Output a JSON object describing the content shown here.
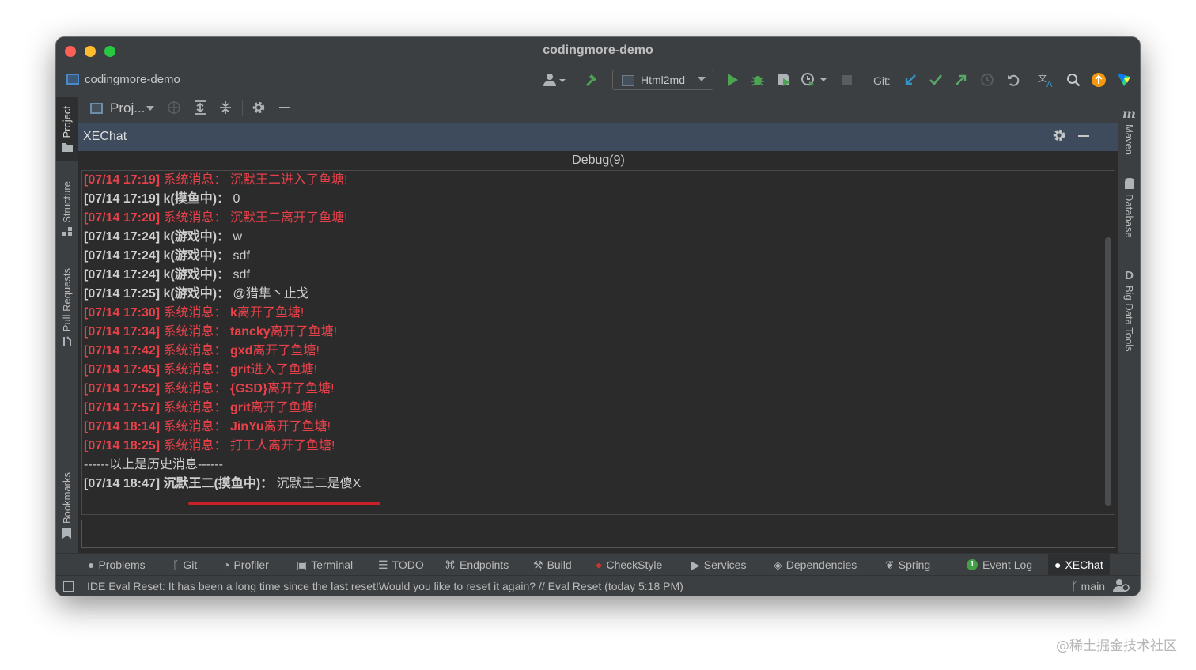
{
  "window": {
    "title": "codingmore-demo"
  },
  "navbar": {
    "project_name": "codingmore-demo",
    "run_config": "Html2md",
    "git_label": "Git:"
  },
  "left_stripe": {
    "project": "Project",
    "structure": "Structure",
    "pull_requests": "Pull Requests",
    "bookmarks": "Bookmarks"
  },
  "right_stripe": {
    "maven": "Maven",
    "database": "Database",
    "big_data_tools": "Big Data Tools"
  },
  "project_toolbar": {
    "label": "Proj..."
  },
  "panel": {
    "title": "XEChat",
    "tab": "Debug(9)"
  },
  "chat": {
    "lines": [
      {
        "type": "sys",
        "time": "[07/14 17:19]",
        "sender": "系统消息：",
        "name": "",
        "text": "沉默王二进入了鱼塘!"
      },
      {
        "type": "user",
        "time": "[07/14 17:19]",
        "sender": "k(摸鱼中)：",
        "name": "",
        "text": "0"
      },
      {
        "type": "sys",
        "time": "[07/14 17:20]",
        "sender": "系统消息：",
        "name": "",
        "text": "沉默王二离开了鱼塘!"
      },
      {
        "type": "user",
        "time": "[07/14 17:24]",
        "sender": "k(游戏中)：",
        "name": "",
        "text": "w"
      },
      {
        "type": "user",
        "time": "[07/14 17:24]",
        "sender": "k(游戏中)：",
        "name": "",
        "text": "sdf"
      },
      {
        "type": "user",
        "time": "[07/14 17:24]",
        "sender": "k(游戏中)：",
        "name": "",
        "text": "sdf"
      },
      {
        "type": "user",
        "time": "[07/14 17:25]",
        "sender": "k(游戏中)：",
        "name": "",
        "text": "@猎隼丶止戈"
      },
      {
        "type": "sys",
        "time": "[07/14 17:30]",
        "sender": "系统消息：",
        "name": "k",
        "text": "离开了鱼塘!"
      },
      {
        "type": "sys",
        "time": "[07/14 17:34]",
        "sender": "系统消息：",
        "name": "tancky",
        "text": "离开了鱼塘!"
      },
      {
        "type": "sys",
        "time": "[07/14 17:42]",
        "sender": "系统消息：",
        "name": "gxd",
        "text": "离开了鱼塘!"
      },
      {
        "type": "sys",
        "time": "[07/14 17:45]",
        "sender": "系统消息：",
        "name": "grit",
        "text": "进入了鱼塘!"
      },
      {
        "type": "sys",
        "time": "[07/14 17:52]",
        "sender": "系统消息：",
        "name": "{GSD}",
        "text": "离开了鱼塘!"
      },
      {
        "type": "sys",
        "time": "[07/14 17:57]",
        "sender": "系统消息：",
        "name": "grit",
        "text": "离开了鱼塘!"
      },
      {
        "type": "sys",
        "time": "[07/14 18:14]",
        "sender": "系统消息：",
        "name": "JinYu",
        "text": "离开了鱼塘!"
      },
      {
        "type": "sys",
        "time": "[07/14 18:25]",
        "sender": "系统消息：",
        "name": "",
        "text": "打工人离开了鱼塘!"
      },
      {
        "type": "divider",
        "time": "",
        "sender": "",
        "name": "",
        "text": "------以上是历史消息------"
      },
      {
        "type": "user",
        "time": "[07/14 18:47]",
        "sender": "沉默王二(摸鱼中)：",
        "name": "",
        "text": "沉默王二是傻X"
      }
    ]
  },
  "tool_windows": {
    "problems": "Problems",
    "git": "Git",
    "profiler": "Profiler",
    "terminal": "Terminal",
    "todo": "TODO",
    "endpoints": "Endpoints",
    "build": "Build",
    "checkstyle": "CheckStyle",
    "services": "Services",
    "dependencies": "Dependencies",
    "spring": "Spring",
    "event_log": "Event Log",
    "event_log_count": "1",
    "xechat": "XEChat"
  },
  "status": {
    "message": "IDE Eval Reset: It has been a long time since the last reset!Would you like to reset it again? // Eval Reset (today 5:18 PM)",
    "branch": "main"
  },
  "watermark": "@稀土掘金技术社区",
  "colors": {
    "system_message": "#e8414a",
    "user_message": "#cfcfcf",
    "run_green": "#4ca351",
    "git_update_blue": "#3592c4",
    "git_commit_green": "#59a869",
    "accent_orange": "#f49810"
  },
  "icons": {
    "user": "user-icon",
    "build": "hammer-icon",
    "run": "run-icon",
    "debug": "bug-icon",
    "coverage": "coverage-icon",
    "profile": "profile-icon",
    "stop": "stop-icon",
    "git_update": "git-update-icon",
    "git_commit": "git-commit-icon",
    "git_push": "git-push-icon",
    "history": "history-icon",
    "rollback": "rollback-icon",
    "translate": "translate-icon",
    "search": "search-icon",
    "update": "update-icon",
    "jetbrains": "jetbrains-logo-icon"
  }
}
